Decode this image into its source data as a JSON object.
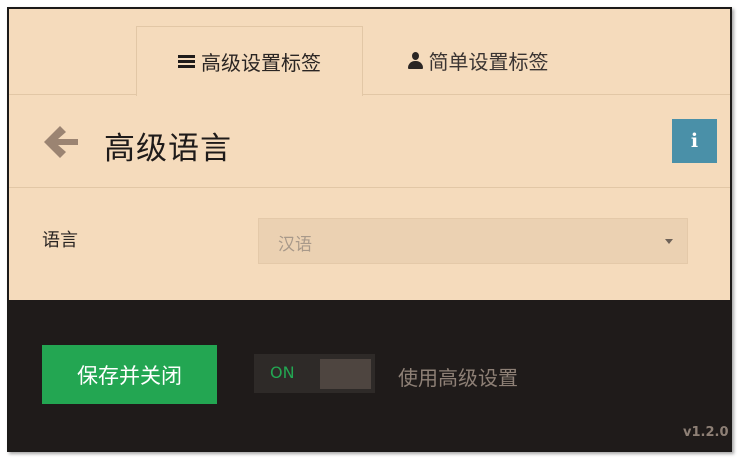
{
  "tabs": [
    {
      "label": "高级设置标签",
      "icon": "hamburger-icon",
      "active": true
    },
    {
      "label": "简单设置标签",
      "icon": "user-icon",
      "active": false
    }
  ],
  "header": {
    "title": "高级语言",
    "back_icon": "back-arrow-icon",
    "info_icon": "info-icon",
    "info_glyph": "i"
  },
  "language": {
    "label": "语言",
    "selected": "汉语"
  },
  "footer": {
    "save_label": "保存并关闭",
    "toggle_state": "ON",
    "toggle_label": "使用高级设置",
    "version": "v1.2.0"
  },
  "colors": {
    "panel_bg": "#f5dbbc",
    "footer_bg": "#1f1b1a",
    "save_green": "#23a652",
    "info_blue": "#4a90a8"
  }
}
